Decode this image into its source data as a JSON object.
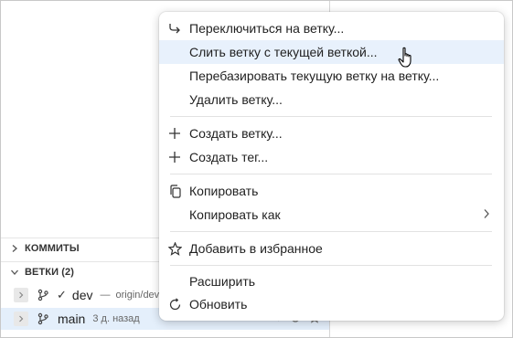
{
  "sidebar": {
    "commits_header": "КОММИТЫ",
    "branches_header": "ВЕТКИ (2)",
    "branches": [
      {
        "name": "dev",
        "current": true,
        "check": "✓",
        "separator": "—",
        "upstream": "origin/dev"
      },
      {
        "name": "main",
        "current": false,
        "check": "",
        "separator": "",
        "upstream": "3 д. назад"
      }
    ]
  },
  "context_menu": {
    "items": [
      {
        "label": "Переключиться на ветку...",
        "icon": "switch-arrow-icon"
      },
      {
        "label": "Слить ветку с текущей веткой...",
        "icon": "",
        "highlighted": true
      },
      {
        "label": "Перебазировать текущую ветку на ветку...",
        "icon": ""
      },
      {
        "label": "Удалить ветку...",
        "icon": ""
      },
      {
        "label": "Создать ветку...",
        "icon": "plus-icon"
      },
      {
        "label": "Создать тег...",
        "icon": "plus-icon"
      },
      {
        "label": "Копировать",
        "icon": "copy-icon"
      },
      {
        "label": "Копировать как",
        "icon": "",
        "submenu": true
      },
      {
        "label": "Добавить в избранное",
        "icon": "star-icon"
      },
      {
        "label": "Расширить",
        "icon": ""
      },
      {
        "label": "Обновить",
        "icon": "refresh-icon"
      }
    ]
  },
  "colors": {
    "highlight": "#e8f1fc",
    "selected_row": "#e4effb",
    "text": "#222222"
  }
}
